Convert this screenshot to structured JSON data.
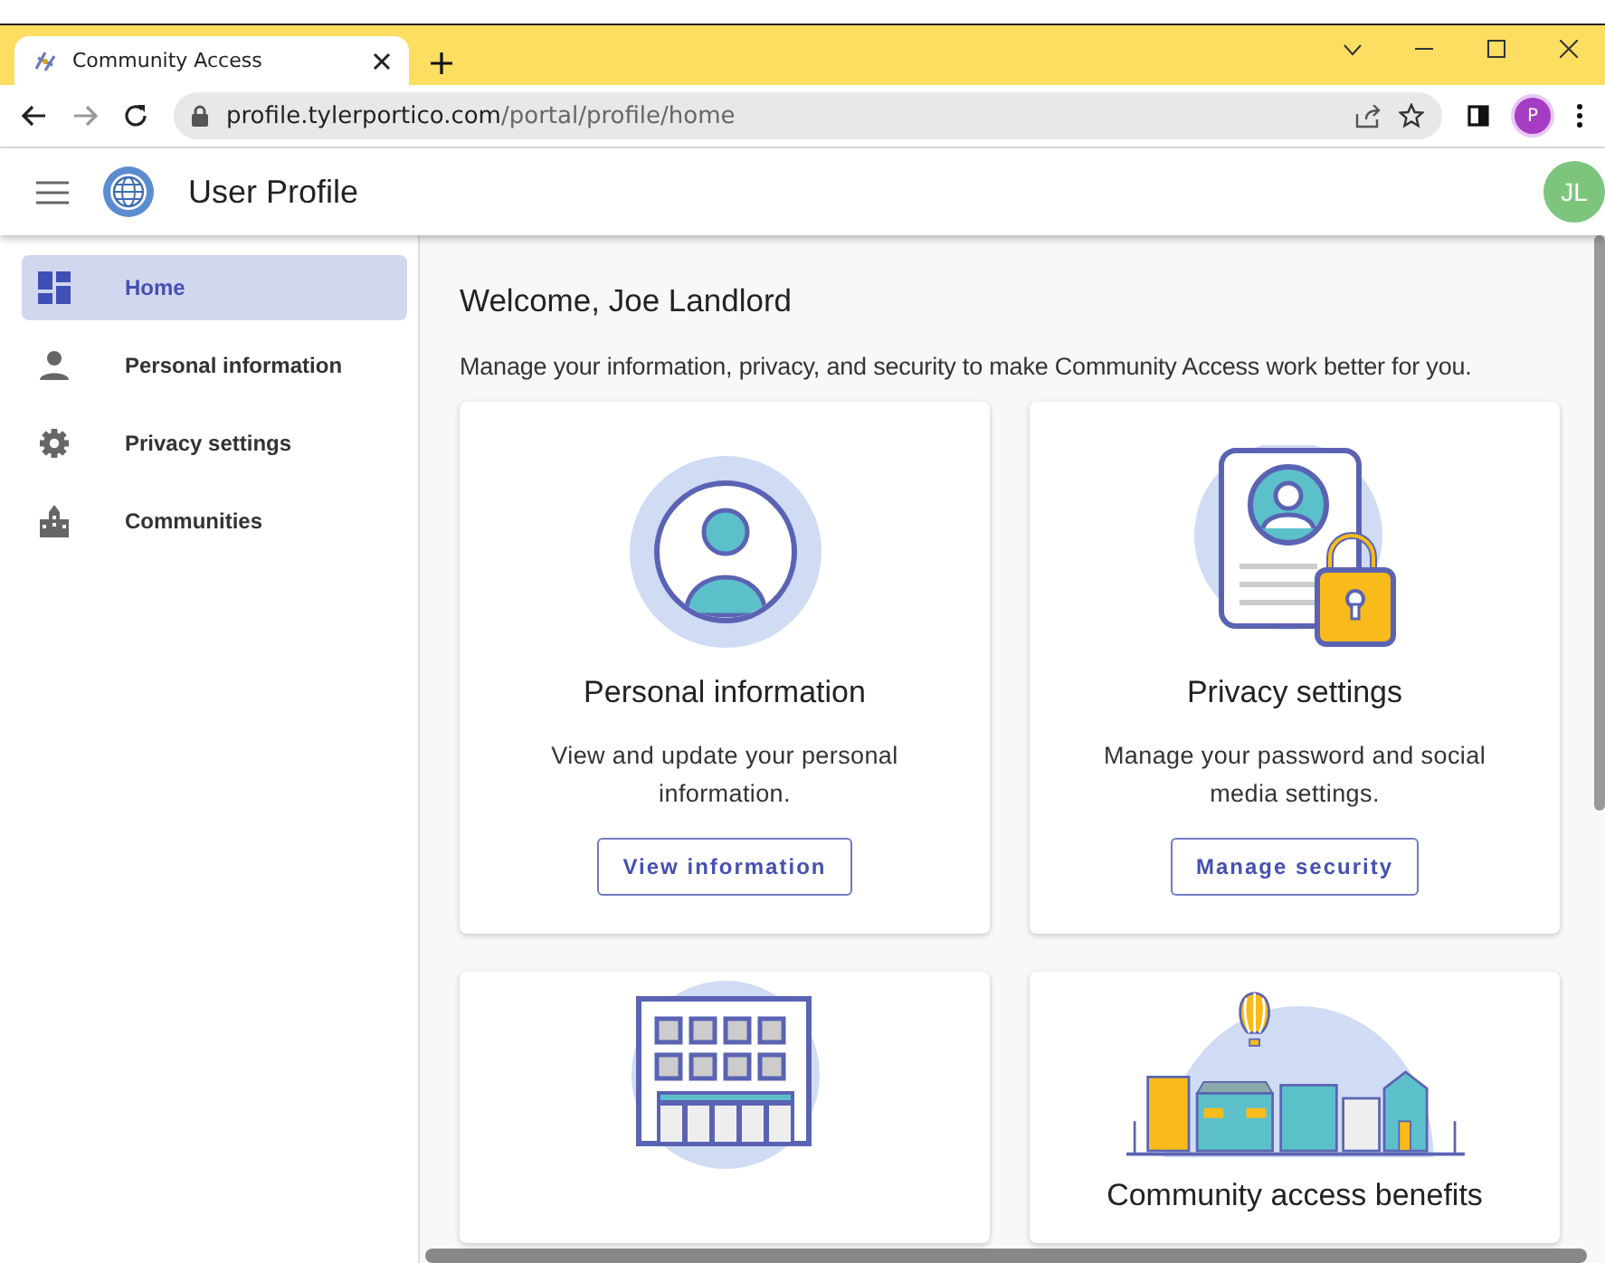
{
  "browser": {
    "tab_title": "Community Access",
    "url_host": "profile.tylerportico.com",
    "url_path": "/portal/profile/home",
    "profile_initial": "P"
  },
  "app": {
    "title": "User Profile",
    "avatar_initials": "JL"
  },
  "sidebar": {
    "items": [
      {
        "label": "Home",
        "kind": "dashboard",
        "selected": true
      },
      {
        "label": "Personal information",
        "kind": "person",
        "selected": false
      },
      {
        "label": "Privacy settings",
        "kind": "gear",
        "selected": false
      },
      {
        "label": "Communities",
        "kind": "city",
        "selected": false
      }
    ]
  },
  "welcome": {
    "heading": "Welcome, Joe Landlord",
    "intro": "Manage your information, privacy, and security to make Community Access work better for you."
  },
  "cards": [
    {
      "kind": "person",
      "title": "Personal information",
      "description": "View and update your personal information.",
      "button": "View information"
    },
    {
      "kind": "privacy",
      "title": "Privacy settings",
      "description": "Manage your password and social media settings.",
      "button": "Manage security"
    },
    {
      "kind": "building"
    },
    {
      "kind": "town",
      "title": "Community access benefits"
    }
  ]
}
